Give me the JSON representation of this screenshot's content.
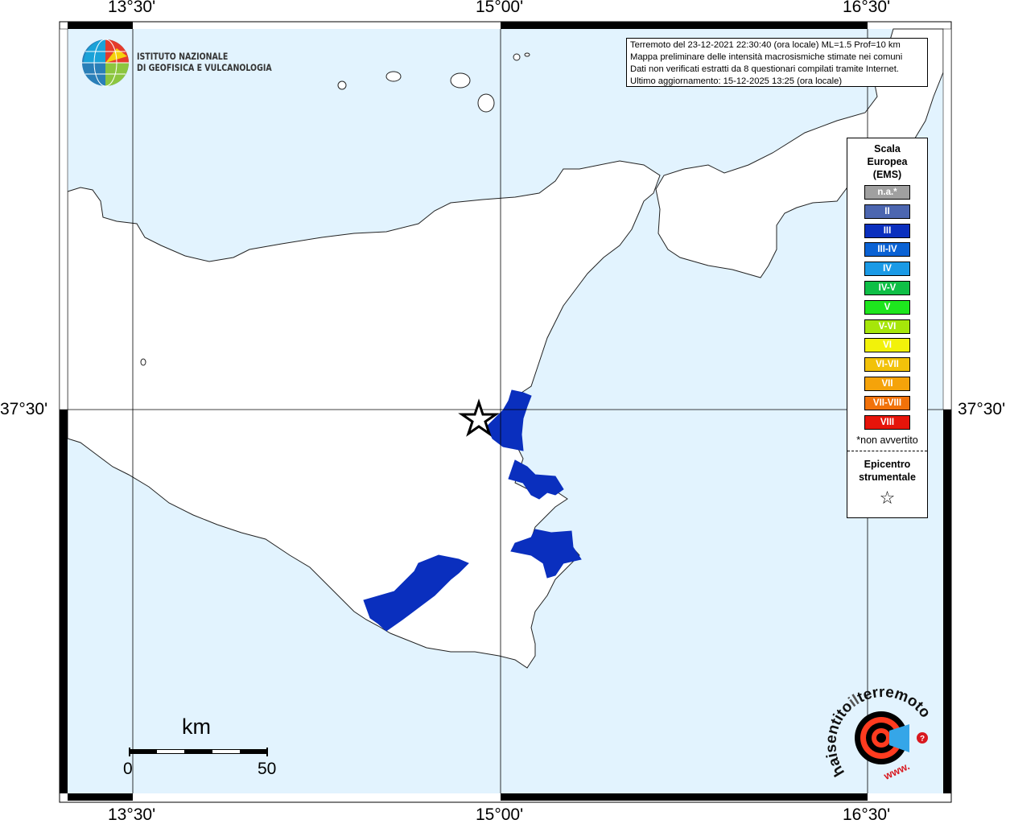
{
  "map": {
    "top_labels": [
      "13°30'",
      "15°00'",
      "16°30'"
    ],
    "bottom_labels": [
      "13°30'",
      "15°00'",
      "16°30'"
    ],
    "left_label": "37°30'",
    "right_label": "37°30'"
  },
  "logo_ingv": {
    "line1": "ISTITUTO NAZIONALE",
    "line2": "DI GEOFISICA E VULCANOLOGIA"
  },
  "info_box": {
    "lines": [
      "Terremoto del 23-12-2021 22:30:40 (ora locale) ML=1.5 Prof=10 km",
      "Mappa preliminare delle intensità macrosismiche stimate nei comuni",
      "Dati non verificati estratti da 8 questionari compilati tramite Internet.",
      "Ultimo aggiornamento: 15-12-2025 13:25 (ora locale)"
    ]
  },
  "legend": {
    "title_lines": [
      "Scala",
      "Europea",
      "(EMS)"
    ],
    "items": [
      {
        "label": "n.a.*",
        "color": "#a0a0a0"
      },
      {
        "label": "II",
        "color": "#4c66b0"
      },
      {
        "label": "III",
        "color": "#0a2fbe"
      },
      {
        "label": "III-IV",
        "color": "#0a62d4"
      },
      {
        "label": "IV",
        "color": "#1a9ae6"
      },
      {
        "label": "IV-V",
        "color": "#0fbf46"
      },
      {
        "label": "V",
        "color": "#1ee61e"
      },
      {
        "label": "V-VI",
        "color": "#a6e60a"
      },
      {
        "label": "VI",
        "color": "#f2f20a"
      },
      {
        "label": "VI-VII",
        "color": "#f2c20a"
      },
      {
        "label": "VII",
        "color": "#f5a30a"
      },
      {
        "label": "VII-VIII",
        "color": "#f2720a"
      },
      {
        "label": "VIII",
        "color": "#e6140a"
      }
    ],
    "note": "*non avvertito",
    "epicenter_lines": [
      "Epicentro",
      "strumentale"
    ],
    "star_icon": "star-outline-icon"
  },
  "scale_bar": {
    "unit": "km",
    "start": "0",
    "end": "50"
  },
  "logo_hsit": {
    "text": "hai sentito il terremoto.it",
    "url_text": "www."
  },
  "colors": {
    "sea": "#e2f3fe",
    "land": "#ffffff",
    "intensity_III": "#0a2fbe"
  }
}
